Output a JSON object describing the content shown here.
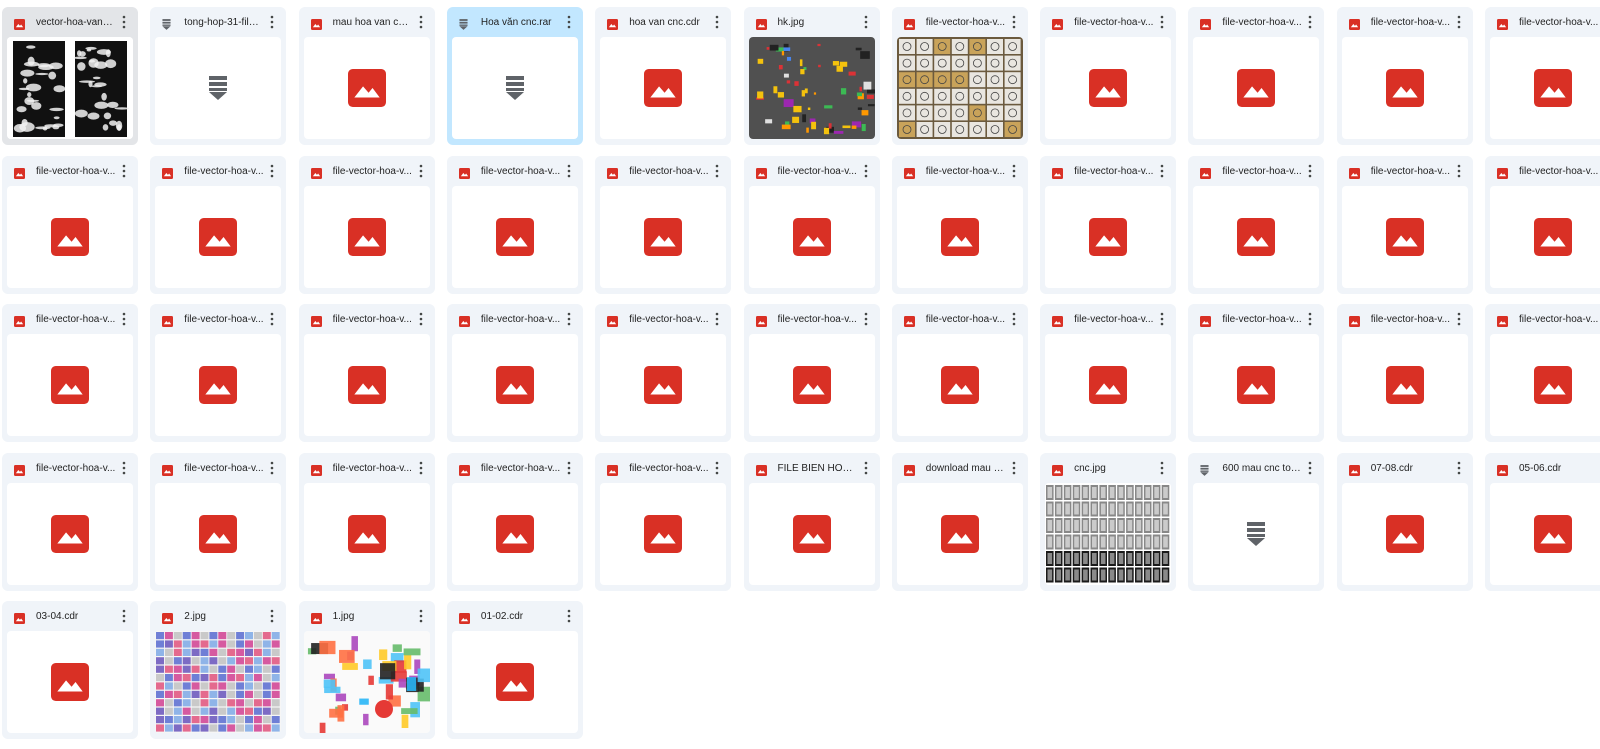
{
  "colors": {
    "card_bg": "#f0f4f9",
    "selected_bg": "#c2e7ff",
    "image_icon": "#d93025",
    "archive_icon": "#5f6368"
  },
  "files": [
    {
      "name": "vector-hoa-van-l...",
      "icon": "image-file-icon",
      "thumb": "bw-peacock-panels",
      "state": "hovered"
    },
    {
      "name": "tong-hop-31-file-...",
      "icon": "archive-file-icon",
      "thumb": "archive-placeholder",
      "state": "normal"
    },
    {
      "name": "mau hoa van con ...",
      "icon": "image-file-icon",
      "thumb": "image-placeholder",
      "state": "normal"
    },
    {
      "name": "Hoa văn cnc.rar",
      "icon": "archive-file-icon",
      "thumb": "archive-placeholder",
      "state": "selected"
    },
    {
      "name": "hoa van cnc.cdr",
      "icon": "image-file-icon",
      "thumb": "image-placeholder",
      "state": "normal"
    },
    {
      "name": "hk.jpg",
      "icon": "image-file-icon",
      "thumb": "dark-color-blocks",
      "state": "normal"
    },
    {
      "name": "file-vector-hoa-v...",
      "icon": "image-file-icon",
      "thumb": "pattern-grid-gold",
      "state": "normal"
    },
    {
      "name": "file-vector-hoa-v...",
      "icon": "image-file-icon",
      "thumb": "image-placeholder",
      "state": "normal"
    },
    {
      "name": "file-vector-hoa-v...",
      "icon": "image-file-icon",
      "thumb": "image-placeholder",
      "state": "normal"
    },
    {
      "name": "file-vector-hoa-v...",
      "icon": "image-file-icon",
      "thumb": "image-placeholder",
      "state": "normal"
    },
    {
      "name": "file-vector-hoa-v...",
      "icon": "image-file-icon",
      "thumb": "image-placeholder",
      "state": "normal"
    },
    {
      "name": "file-vector-hoa-v...",
      "icon": "image-file-icon",
      "thumb": "image-placeholder",
      "state": "normal"
    },
    {
      "name": "file-vector-hoa-v...",
      "icon": "image-file-icon",
      "thumb": "image-placeholder",
      "state": "normal"
    },
    {
      "name": "file-vector-hoa-v...",
      "icon": "image-file-icon",
      "thumb": "image-placeholder",
      "state": "normal"
    },
    {
      "name": "file-vector-hoa-v...",
      "icon": "image-file-icon",
      "thumb": "image-placeholder",
      "state": "normal"
    },
    {
      "name": "file-vector-hoa-v...",
      "icon": "image-file-icon",
      "thumb": "image-placeholder",
      "state": "normal"
    },
    {
      "name": "file-vector-hoa-v...",
      "icon": "image-file-icon",
      "thumb": "image-placeholder",
      "state": "normal"
    },
    {
      "name": "file-vector-hoa-v...",
      "icon": "image-file-icon",
      "thumb": "image-placeholder",
      "state": "normal"
    },
    {
      "name": "file-vector-hoa-v...",
      "icon": "image-file-icon",
      "thumb": "image-placeholder",
      "state": "normal"
    },
    {
      "name": "file-vector-hoa-v...",
      "icon": "image-file-icon",
      "thumb": "image-placeholder",
      "state": "normal"
    },
    {
      "name": "file-vector-hoa-v...",
      "icon": "image-file-icon",
      "thumb": "image-placeholder",
      "state": "normal"
    },
    {
      "name": "file-vector-hoa-v...",
      "icon": "image-file-icon",
      "thumb": "image-placeholder",
      "state": "normal"
    },
    {
      "name": "file-vector-hoa-v...",
      "icon": "image-file-icon",
      "thumb": "image-placeholder",
      "state": "normal"
    },
    {
      "name": "file-vector-hoa-v...",
      "icon": "image-file-icon",
      "thumb": "image-placeholder",
      "state": "normal"
    },
    {
      "name": "file-vector-hoa-v...",
      "icon": "image-file-icon",
      "thumb": "image-placeholder",
      "state": "normal"
    },
    {
      "name": "file-vector-hoa-v...",
      "icon": "image-file-icon",
      "thumb": "image-placeholder",
      "state": "normal"
    },
    {
      "name": "file-vector-hoa-v...",
      "icon": "image-file-icon",
      "thumb": "image-placeholder",
      "state": "normal"
    },
    {
      "name": "file-vector-hoa-v...",
      "icon": "image-file-icon",
      "thumb": "image-placeholder",
      "state": "normal"
    },
    {
      "name": "file-vector-hoa-v...",
      "icon": "image-file-icon",
      "thumb": "image-placeholder",
      "state": "normal"
    },
    {
      "name": "file-vector-hoa-v...",
      "icon": "image-file-icon",
      "thumb": "image-placeholder",
      "state": "normal"
    },
    {
      "name": "file-vector-hoa-v...",
      "icon": "image-file-icon",
      "thumb": "image-placeholder",
      "state": "normal"
    },
    {
      "name": "file-vector-hoa-v...",
      "icon": "image-file-icon",
      "thumb": "image-placeholder",
      "state": "normal"
    },
    {
      "name": "file-vector-hoa-v...",
      "icon": "image-file-icon",
      "thumb": "image-placeholder",
      "state": "normal"
    },
    {
      "name": "file-vector-hoa-v...",
      "icon": "image-file-icon",
      "thumb": "image-placeholder",
      "state": "normal"
    },
    {
      "name": "file-vector-hoa-v...",
      "icon": "image-file-icon",
      "thumb": "image-placeholder",
      "state": "normal"
    },
    {
      "name": "file-vector-hoa-v...",
      "icon": "image-file-icon",
      "thumb": "image-placeholder",
      "state": "normal"
    },
    {
      "name": "file-vector-hoa-v...",
      "icon": "image-file-icon",
      "thumb": "image-placeholder",
      "state": "normal"
    },
    {
      "name": "file-vector-hoa-v...",
      "icon": "image-file-icon",
      "thumb": "image-placeholder",
      "state": "normal"
    },
    {
      "name": "FILE BIEN HONG ...",
      "icon": "image-file-icon",
      "thumb": "image-placeholder",
      "state": "normal"
    },
    {
      "name": "download mau h...",
      "icon": "image-file-icon",
      "thumb": "image-placeholder",
      "state": "normal"
    },
    {
      "name": "cnc.jpg",
      "icon": "image-file-icon",
      "thumb": "bw-cnc-grid",
      "state": "normal"
    },
    {
      "name": "600 mau cnc ton...",
      "icon": "archive-file-icon",
      "thumb": "archive-placeholder",
      "state": "normal"
    },
    {
      "name": "07-08.cdr",
      "icon": "image-file-icon",
      "thumb": "image-placeholder",
      "state": "normal"
    },
    {
      "name": "05-06.cdr",
      "icon": "image-file-icon",
      "thumb": "image-placeholder",
      "state": "normal"
    },
    {
      "name": "03-04.cdr",
      "icon": "image-file-icon",
      "thumb": "image-placeholder",
      "state": "normal"
    },
    {
      "name": "2.jpg",
      "icon": "image-file-icon",
      "thumb": "color-pattern-rows",
      "state": "normal"
    },
    {
      "name": "1.jpg",
      "icon": "image-file-icon",
      "thumb": "color-pattern-collage",
      "state": "normal"
    },
    {
      "name": "01-02.cdr",
      "icon": "image-file-icon",
      "thumb": "image-placeholder",
      "state": "normal"
    }
  ]
}
